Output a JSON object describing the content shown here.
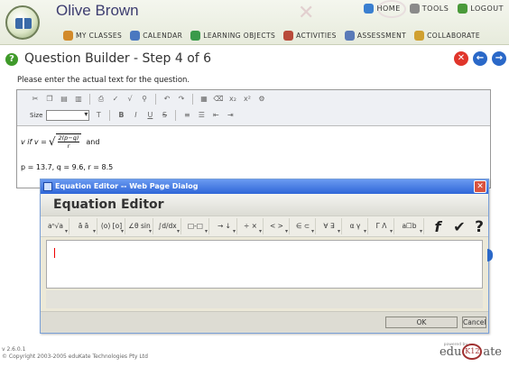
{
  "header": {
    "user_name": "Olive Brown",
    "top_links": [
      {
        "label": "HOME",
        "icon": "home-icon"
      },
      {
        "label": "TOOLS",
        "icon": "wrench-icon"
      },
      {
        "label": "LOGOUT",
        "icon": "logout-icon"
      }
    ],
    "nav": [
      {
        "label": "MY CLASSES",
        "icon": "classes-icon"
      },
      {
        "label": "CALENDAR",
        "icon": "calendar-icon"
      },
      {
        "label": "LEARNING OBJECTS",
        "icon": "learning-objects-icon"
      },
      {
        "label": "ACTIVITIES",
        "icon": "activities-icon"
      },
      {
        "label": "ASSESSMENT",
        "icon": "assessment-icon"
      },
      {
        "label": "COLLABORATE",
        "icon": "collaborate-icon"
      }
    ]
  },
  "page": {
    "title": "Question Builder - Step 4 of 6",
    "instructions": "Please enter the actual text for the question."
  },
  "editor": {
    "size_label": "Size",
    "line1_prefix": "v if v =",
    "line1_num": "2(p−q)",
    "line1_den": "r",
    "line1_suffix": "and",
    "line2": "p = 13.7, q = 9.6, r = 8.5"
  },
  "dialog": {
    "window_title": "Equation Editor -- Web Page Dialog",
    "heading": "Equation Editor",
    "palette": [
      "aⁿ√a",
      "ā ā",
      "(o) [o]",
      "∠θ sin",
      "∫d/dx",
      "□-□",
      "→ ↓",
      "÷ ×",
      "< >",
      "∈ ⊂",
      "∀ ∃",
      "α γ",
      "Γ Λ",
      "a☐b"
    ],
    "ok_label": "OK",
    "cancel_label": "Cancel"
  },
  "footer": {
    "version": "v 2.6.0.1",
    "copyright": "© Copyright 2003-2005 eduKate Technologies Pty Ltd",
    "powered_by": "powered by",
    "brand_pre": "edu",
    "brand_k12": "K12",
    "brand_post": "ate"
  }
}
